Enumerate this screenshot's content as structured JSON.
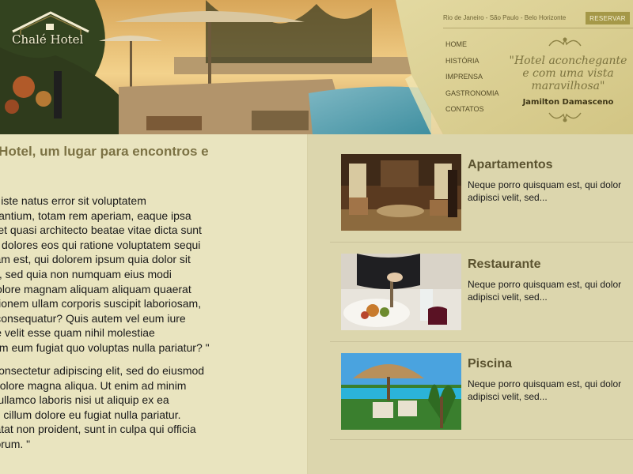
{
  "header": {
    "logo_text": "Chalé Hotel",
    "location": "Rio de Janeiro - São Paulo - Belo Horizonte",
    "reserve_label": "RESERVAR",
    "nav": [
      "HOME",
      "HISTÓRIA",
      "IMPRENSA",
      "GASTRONOMIA",
      "CONTATOS"
    ],
    "tagline": "\"Hotel aconchegante e com uma vista maravilhosa\"",
    "tagline_author": "Jamilton Damasceno"
  },
  "main": {
    "welcome_title": "é Hotel, um lugar para encontros e",
    "para1_lines": [
      " omnis iste natus error sit voluptatem",
      "e laudantium, totam rem aperiam, eaque ipsa",
      "ritatis et quasi architecto beatae vitae dicta sunt",
      "magni dolores eos qui ratione voluptatem sequi",
      "uisquam est, qui dolorem ipsum quia dolor sit",
      "ci velit, sed quia non numquam eius modi",
      "e et dolore magnam aliquam aliquam quaerat",
      "ercitationem ullam corporis suscipit laboriosam,",
      "modi consequatur? Quis autem vel eum iure",
      "luptate velit esse quam nihil molestiae",
      " dolorem eum fugiat quo voluptas nulla pariatur? \""
    ],
    "para2_lines": [
      "met, consectetur adipiscing elit, sed do eiusmod",
      "re et dolore magna aliqua. Ut enim ad minim",
      "rcício ullamco laboris nisi ut aliquip ex ea",
      "it esse cillum dolore eu fugiat nulla pariatur.",
      "cupidatat non proident, sunt in culpa qui officia",
      "st laborum. \""
    ]
  },
  "cards": [
    {
      "title": "Apartamentos",
      "desc_line1": "Neque porro quisquam est, qui dolor",
      "desc_line2": "adipisci velit, sed..."
    },
    {
      "title": "Restaurante",
      "desc_line1": "Neque porro quisquam est, qui dolor",
      "desc_line2": "adipisci velit, sed..."
    },
    {
      "title": "Piscina",
      "desc_line1": "Neque porro quisquam est, qui dolor",
      "desc_line2": "adipisci velit, sed..."
    }
  ],
  "colors": {
    "gold_panel": "#d9cf94",
    "button": "#a59848",
    "title_text": "#7c7244",
    "background": "#e7e2bd"
  },
  "icons": [
    "house-roof-icon",
    "flourish-top-icon",
    "flourish-bottom-icon"
  ]
}
